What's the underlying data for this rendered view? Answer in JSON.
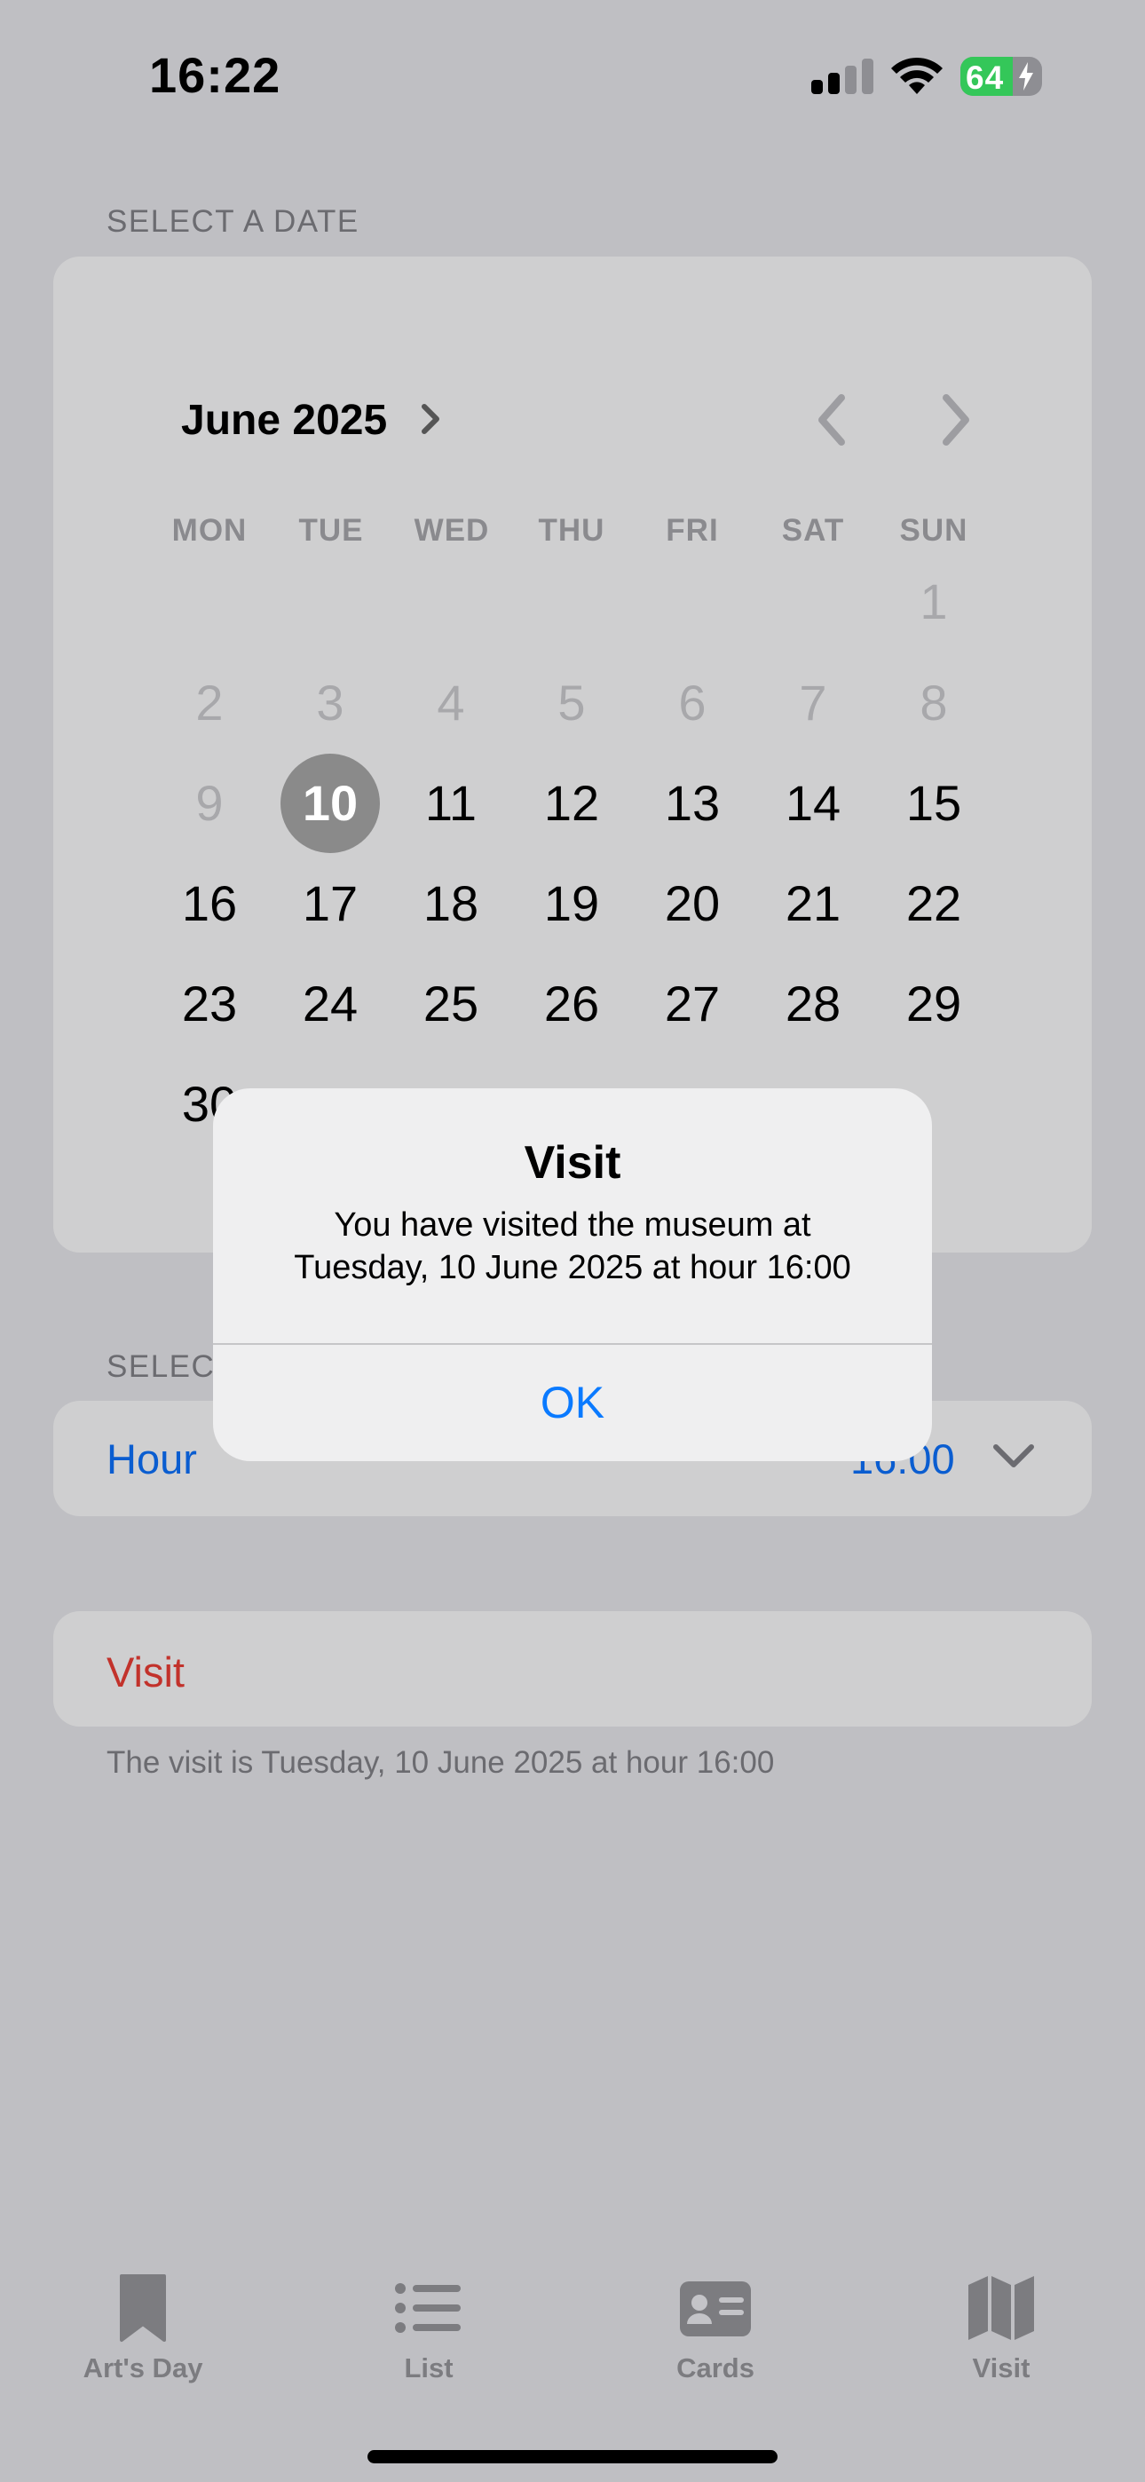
{
  "status_bar": {
    "time": "16:22",
    "battery_percent": "64",
    "battery_level": 0.64
  },
  "date_section": {
    "label": "SELECT A DATE"
  },
  "calendar": {
    "month_title": "June 2025",
    "weekdays": [
      "MON",
      "TUE",
      "WED",
      "THU",
      "FRI",
      "SAT",
      "SUN"
    ],
    "selected_day": "10",
    "dimmed_days": [
      "1",
      "2",
      "3",
      "4",
      "5",
      "6",
      "7",
      "8",
      "9"
    ],
    "active_days": [
      "11",
      "12",
      "13",
      "14",
      "15",
      "16",
      "17",
      "18",
      "19",
      "20",
      "21",
      "22",
      "23",
      "24",
      "25",
      "26",
      "27",
      "28",
      "29",
      "30"
    ]
  },
  "time_section": {
    "label": "SELECT",
    "hour_label": "Hour",
    "hour_value": "16:00"
  },
  "visit": {
    "button_label": "Visit",
    "note": "The visit is Tuesday, 10 June 2025 at hour  16:00"
  },
  "alert": {
    "title": "Visit",
    "message_line1": "You have visited the museum at",
    "message_line2": "Tuesday, 10 June 2025 at hour  16:00",
    "ok_label": "OK"
  },
  "tabs": [
    {
      "label": "Art's Day",
      "icon": "bookmark-icon"
    },
    {
      "label": "List",
      "icon": "list-icon"
    },
    {
      "label": "Cards",
      "icon": "person-card-icon"
    },
    {
      "label": "Visit",
      "icon": "map-icon"
    }
  ],
  "colors": {
    "accent_blue": "#0a5dd0",
    "alert_blue": "#0a7aff",
    "visit_red": "#c2322b",
    "battery_green": "#34c759"
  }
}
